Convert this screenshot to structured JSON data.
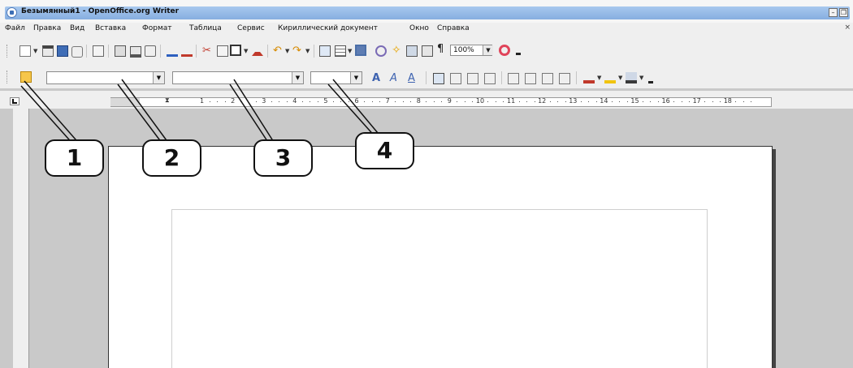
{
  "window": {
    "title": "Безымянный1 - OpenOffice.org Writer",
    "minimize": "–",
    "maximize": "❐"
  },
  "menu": {
    "items": [
      "Файл",
      "Правка",
      "Вид",
      "Вставка",
      "Формат",
      "Таблица",
      "Сервис",
      "Кириллический документ",
      "Окно",
      "Справка"
    ],
    "close": "×"
  },
  "toolbar": {
    "zoom_value": "100%",
    "pilcrow": "¶"
  },
  "ruler": {
    "numbers": [
      "1",
      "2",
      "3",
      "4",
      "5",
      "6",
      "7",
      "8",
      "9",
      "10",
      "11",
      "12",
      "13",
      "14",
      "15",
      "16",
      "17",
      "18"
    ]
  },
  "callouts": [
    "1",
    "2",
    "3",
    "4"
  ],
  "colors": {
    "title_bar": "#94b8e8",
    "toolbar": "#efefef",
    "workspace": "#c9c9c9",
    "page": "#ffffff"
  },
  "icons": [
    "app-icon",
    "new-document-icon",
    "open-icon",
    "save-icon",
    "email-icon",
    "edit-document-icon",
    "export-pdf-icon",
    "print-icon",
    "print-preview-icon",
    "spellcheck-icon",
    "autospellcheck-icon",
    "cut-icon",
    "copy-icon",
    "paste-icon",
    "format-paintbrush-icon",
    "undo-icon",
    "redo-icon",
    "hyperlink-icon",
    "table-icon",
    "show-draw-functions-icon",
    "find-replace-icon",
    "navigator-icon",
    "gallery-icon",
    "data-sources-icon",
    "help-icon",
    "styles-formatting-icon",
    "bold-icon",
    "italic-icon",
    "underline-icon",
    "align-left-icon",
    "align-center-icon",
    "align-right-icon",
    "justify-icon",
    "numbering-icon",
    "bullets-icon",
    "decrease-indent-icon",
    "increase-indent-icon",
    "font-color-icon",
    "highlight-icon",
    "background-color-icon"
  ]
}
